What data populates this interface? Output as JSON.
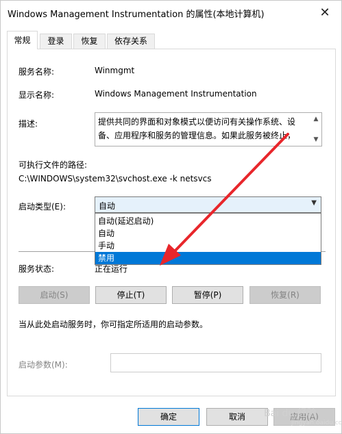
{
  "window": {
    "title": "Windows Management Instrumentation 的属性(本地计算机)",
    "close_glyph": "✕"
  },
  "tabs": [
    {
      "label": "常规",
      "active": true
    },
    {
      "label": "登录"
    },
    {
      "label": "恢复"
    },
    {
      "label": "依存关系"
    }
  ],
  "general": {
    "service_name_label": "服务名称:",
    "service_name": "Winmgmt",
    "display_name_label": "显示名称:",
    "display_name": "Windows Management Instrumentation",
    "description_label": "描述:",
    "description": "提供共同的界面和对象模式以便访问有关操作系统、设备、应用程序和服务的管理信息。如果此服务被终止，",
    "path_label": "可执行文件的路径:",
    "path": "C:\\WINDOWS\\system32\\svchost.exe -k netsvcs",
    "startup_type_label": "启动类型(E):",
    "startup_type_value": "自动",
    "startup_options": [
      "自动(延迟启动)",
      "自动",
      "手动",
      "禁用"
    ],
    "startup_selected_index": 3,
    "status_label": "服务状态:",
    "status_value": "正在运行",
    "buttons": {
      "start": "启动(S)",
      "stop": "停止(T)",
      "pause": "暂停(P)",
      "resume": "恢复(R)"
    },
    "hint": "当从此处启动服务时，你可指定所适用的启动参数。",
    "params_label": "启动参数(M):",
    "params_value": ""
  },
  "footer": {
    "ok": "确定",
    "cancel": "取消",
    "apply": "应用(A)"
  },
  "watermark": {
    "brand": "Bai du 经验",
    "url": "jingyan.baidu.com"
  },
  "colors": {
    "selection": "#0078d7",
    "arrow": "#e8262b",
    "combo_bg": "#e5f1fb"
  }
}
